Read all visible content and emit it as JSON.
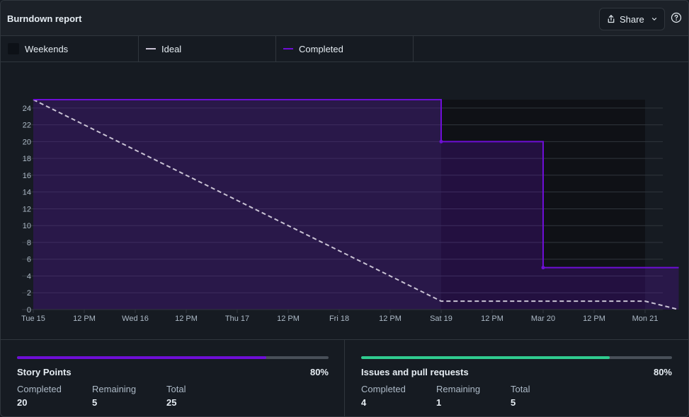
{
  "header": {
    "title": "Burndown report",
    "share_label": "Share"
  },
  "legend": {
    "weekends_label": "Weekends",
    "ideal_label": "Ideal",
    "completed_label": "Completed"
  },
  "colors": {
    "completed": "#6e0ed6",
    "ideal": "#c9c3d4",
    "issues_bar": "#2fcb8f",
    "track": "#484f58"
  },
  "chart_data": {
    "type": "line",
    "x_tick_labels": [
      "Tue 15",
      "12 PM",
      "Wed 16",
      "12 PM",
      "Thu 17",
      "12 PM",
      "Fri 18",
      "12 PM",
      "Sat 19",
      "12 PM",
      "Mar 20",
      "12 PM",
      "Mon 21"
    ],
    "y_ticks": [
      0,
      2,
      4,
      6,
      8,
      10,
      12,
      14,
      16,
      18,
      20,
      22,
      24
    ],
    "ylim": [
      0,
      25
    ],
    "xlim_days": [
      0,
      6.33
    ],
    "weekend_span_days": [
      4,
      6
    ],
    "series": [
      {
        "name": "Ideal",
        "style": "dashed",
        "points": [
          [
            0,
            25
          ],
          [
            4,
            1
          ],
          [
            6,
            1
          ],
          [
            6.33,
            0
          ]
        ]
      },
      {
        "name": "Completed",
        "style": "step",
        "points": [
          [
            0,
            25
          ],
          [
            4,
            25
          ],
          [
            4,
            20
          ],
          [
            5,
            20
          ],
          [
            5,
            5
          ],
          [
            6.33,
            5
          ]
        ]
      }
    ]
  },
  "stats": [
    {
      "title": "Story Points",
      "percent_label": "80%",
      "percent": 0.8,
      "completed_label": "Completed",
      "completed": "20",
      "remaining_label": "Remaining",
      "remaining": "5",
      "total_label": "Total",
      "total": "25"
    },
    {
      "title": "Issues and pull requests",
      "percent_label": "80%",
      "percent": 0.8,
      "completed_label": "Completed",
      "completed": "4",
      "remaining_label": "Remaining",
      "remaining": "1",
      "total_label": "Total",
      "total": "5"
    }
  ]
}
